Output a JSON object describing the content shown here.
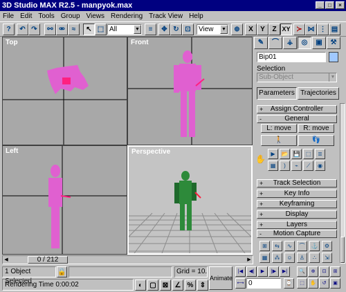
{
  "window": {
    "title": "3D Studio MAX R2.5 - manpyok.max",
    "min": "_",
    "max": "□",
    "close": "×"
  },
  "menu": [
    "File",
    "Edit",
    "Tools",
    "Group",
    "Views",
    "Rendering",
    "Track View",
    "Help"
  ],
  "toolbar": {
    "selection_filter": "All",
    "reference_coord": "View",
    "axis_x": "X",
    "axis_y": "Y",
    "axis_z": "Z",
    "axis_xy": "XY"
  },
  "viewports": {
    "top": "Top",
    "front": "Front",
    "left": "Left",
    "perspective": "Perspective"
  },
  "command_panel": {
    "object_name": "Bip01",
    "selection_label": "Selection",
    "selection_value": "Sub-Object",
    "tab_parameters": "Parameters",
    "tab_trajectories": "Trajectories",
    "rollouts": {
      "assign_controller": "Assign Controller",
      "general": "General",
      "track_selection": "Track Selection",
      "key_info": "Key Info",
      "keyframing": "Keyframing",
      "display": "Display",
      "layers": "Layers",
      "motion_capture": "Motion Capture"
    },
    "l_move": "L: move",
    "r_move": "R: move",
    "plus": "+",
    "minus": "-"
  },
  "timeline": {
    "frame": "0 / 212"
  },
  "status": {
    "selected": "1 Object Selected",
    "render_time": "Rendering Time  0:00:02",
    "grid": "Grid = 10.0",
    "animate": "Animate",
    "frame_field": "0"
  },
  "colors": {
    "biped_selected": "#e060d0",
    "viewport_bg": "#a8a8a8",
    "character_green": "#2d8a3a"
  }
}
